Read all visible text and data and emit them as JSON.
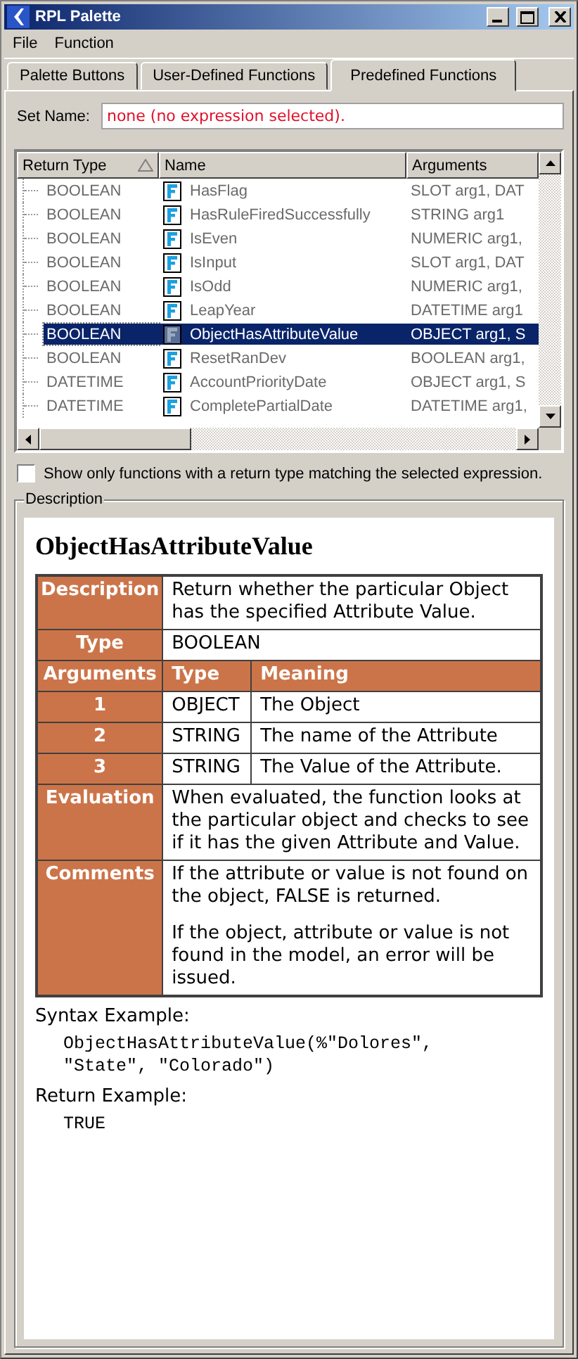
{
  "window": {
    "title": "RPL Palette"
  },
  "menu": [
    "File",
    "Function"
  ],
  "tabs": [
    {
      "label": "Palette Buttons",
      "selected": false
    },
    {
      "label": "User-Defined Functions",
      "selected": false
    },
    {
      "label": "Predefined Functions",
      "selected": true
    }
  ],
  "set_name": {
    "label": "Set Name:",
    "value": "none (no expression selected)."
  },
  "table": {
    "columns": [
      {
        "label": "Return Type",
        "sorted": true
      },
      {
        "label": "Name",
        "sorted": false
      },
      {
        "label": "Arguments",
        "sorted": false
      }
    ],
    "rows": [
      {
        "return_type": "BOOLEAN",
        "name": "HasFlag",
        "arguments": "SLOT arg1, DAT",
        "selected": false
      },
      {
        "return_type": "BOOLEAN",
        "name": "HasRuleFiredSuccessfully",
        "arguments": "STRING arg1",
        "selected": false
      },
      {
        "return_type": "BOOLEAN",
        "name": "IsEven",
        "arguments": "NUMERIC arg1,",
        "selected": false
      },
      {
        "return_type": "BOOLEAN",
        "name": "IsInput",
        "arguments": "SLOT arg1, DAT",
        "selected": false
      },
      {
        "return_type": "BOOLEAN",
        "name": "IsOdd",
        "arguments": "NUMERIC arg1,",
        "selected": false
      },
      {
        "return_type": "BOOLEAN",
        "name": "LeapYear",
        "arguments": "DATETIME arg1",
        "selected": false
      },
      {
        "return_type": "BOOLEAN",
        "name": "ObjectHasAttributeValue",
        "arguments": "OBJECT arg1, S",
        "selected": true
      },
      {
        "return_type": "BOOLEAN",
        "name": "ResetRanDev",
        "arguments": "BOOLEAN arg1,",
        "selected": false
      },
      {
        "return_type": "DATETIME",
        "name": "AccountPriorityDate",
        "arguments": "OBJECT arg1, S",
        "selected": false
      },
      {
        "return_type": "DATETIME",
        "name": "CompletePartialDate",
        "arguments": "DATETIME arg1,",
        "selected": false
      }
    ]
  },
  "filter_checkbox": {
    "label": "Show only functions with a return type matching the selected expression.",
    "checked": false
  },
  "description": {
    "group_label": "Description",
    "title": "ObjectHasAttributeValue",
    "details": [
      {
        "kind": "field",
        "label": "Description",
        "paragraphs": [
          "Return whether the particular Object has the specified Attribute Value."
        ]
      },
      {
        "kind": "field",
        "label": "Type",
        "paragraphs": [
          "BOOLEAN"
        ]
      },
      {
        "kind": "arg_header",
        "cells": [
          "Arguments",
          "Type",
          "Meaning"
        ]
      },
      {
        "kind": "arg",
        "cells": [
          "1",
          "OBJECT",
          "The Object"
        ]
      },
      {
        "kind": "arg",
        "cells": [
          "2",
          "STRING",
          "The name of the Attribute"
        ]
      },
      {
        "kind": "arg",
        "cells": [
          "3",
          "STRING",
          "The Value of the Attribute."
        ]
      },
      {
        "kind": "field",
        "label": "Evaluation",
        "paragraphs": [
          "When evaluated, the function looks at the particular object and checks to see if it has the given Attribute and Value."
        ]
      },
      {
        "kind": "field",
        "label": "Comments",
        "paragraphs": [
          "If the attribute or value is not found on the object, FALSE is returned.",
          "If the object, attribute or value is not found in the model, an error will be issued."
        ]
      }
    ],
    "syntax_label": "Syntax Example:",
    "syntax_code": "ObjectHasAttributeValue(%\"Dolores\", \"State\", \"Colorado\")",
    "return_label": "Return Example:",
    "return_code": "TRUE"
  }
}
